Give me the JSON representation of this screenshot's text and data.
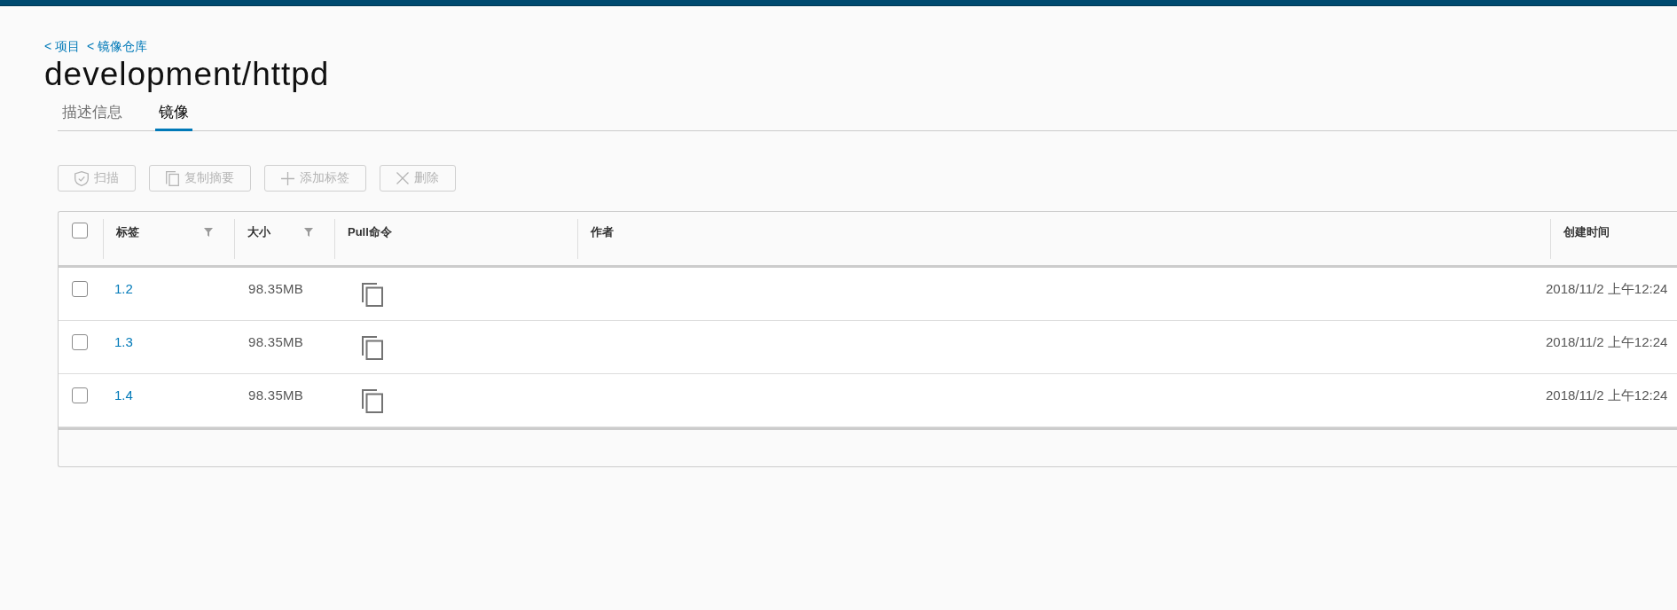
{
  "breadcrumb": [
    {
      "label": "< 项目"
    },
    {
      "label": "< 镜像仓库"
    }
  ],
  "title": "development/httpd",
  "tabs": [
    {
      "label": "描述信息",
      "selected": false
    },
    {
      "label": "镜像",
      "selected": true
    }
  ],
  "toolbar": [
    {
      "kind": "scan",
      "label": "扫描",
      "disabled": true
    },
    {
      "kind": "copy",
      "label": "复制摘要",
      "disabled": true
    },
    {
      "kind": "add",
      "label": "添加标签",
      "disabled": true
    },
    {
      "kind": "delete",
      "label": "删除",
      "disabled": true
    }
  ],
  "table": {
    "header_checkbox": {
      "checked": false
    },
    "columns": [
      {
        "label": "标签",
        "filter": true
      },
      {
        "label": "大小",
        "filter": true
      },
      {
        "label": "Pull命令",
        "filter": false
      },
      {
        "label": "作者",
        "filter": false
      },
      {
        "label": "创建时间",
        "filter": false
      }
    ],
    "rows": [
      {
        "checked": false,
        "tag": "1.2",
        "size": "98.35MB",
        "created": "2018/11/2 上午12:24"
      },
      {
        "checked": false,
        "tag": "1.3",
        "size": "98.35MB",
        "created": "2018/11/2 上午12:24"
      },
      {
        "checked": false,
        "tag": "1.4",
        "size": "98.35MB",
        "created": "2018/11/2 上午12:24"
      }
    ]
  }
}
